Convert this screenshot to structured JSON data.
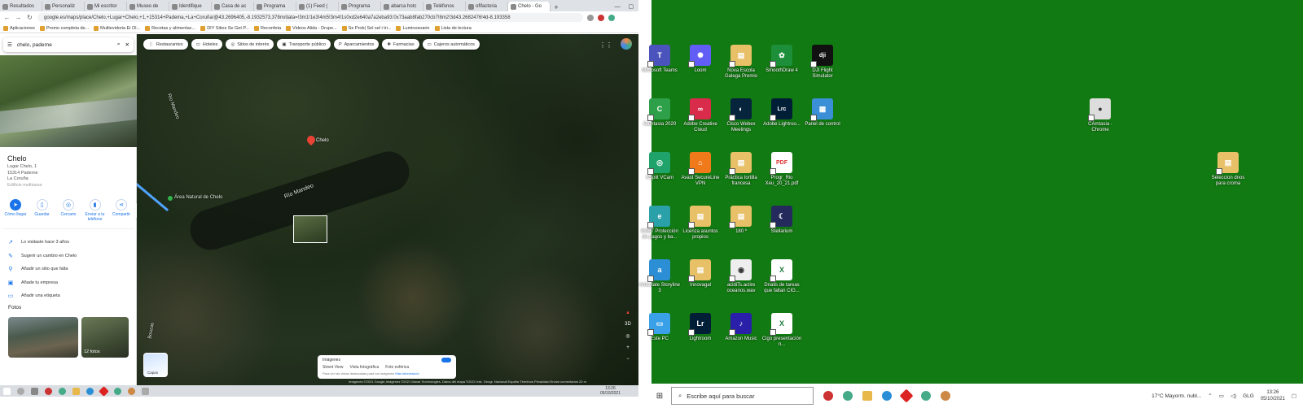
{
  "browser": {
    "tabs": [
      "Resultados",
      "Personaliz",
      "Mi escritor",
      "Museo de",
      "Identifique",
      "Casa de ac",
      "Programa",
      "(1) Feed |",
      "Programa",
      "abarca hotc",
      "Teléfonos",
      "ofifactoria",
      "Chelo - Go"
    ],
    "new_tab": "+",
    "url": "google.es/maps/place/Chelo,+Lugar+Chelo,+1,+15314+Padema,+La+Coruña/@43.2696405,-8.1932573,378m/data=!3m1!1e3!4m5!3m4!1s0xd2e640a7a2eba93:0x73aab8fab270cb7!8m2!3d43.2682476!4d-8.193358",
    "bookmarks": [
      "Aplicaciones",
      "Promo completa de...",
      "Multievidoria Ei Ol...",
      "Recetas y alimentac...",
      "DIY Sitios Se Get P...",
      "Reconfeta",
      "Videos Alida - Drupe...",
      "Se Prob| Sel sel i tri...",
      "Luminosoarin",
      "Lista de lectura"
    ]
  },
  "maps": {
    "search_value": "chelo, paderne",
    "place_title": "Chelo",
    "address_lines": [
      "Lugar Chelo, 1",
      "15314 Paderne",
      "La Coruña"
    ],
    "address_muted": "Edificio multiusos",
    "actions": [
      "Cómo llegar",
      "Guardar",
      "Cercano",
      "Enviar a tu teléfono",
      "Compartir"
    ],
    "menu": [
      {
        "icon": "history-icon",
        "label": "Lo visitaste hace 3 años"
      },
      {
        "icon": "edit-icon",
        "label": "Sugerir un cambio en Chelo"
      },
      {
        "icon": "add-place-icon",
        "label": "Añadir un sitio que falta"
      },
      {
        "icon": "business-icon",
        "label": "Añade tu empresa"
      },
      {
        "icon": "label-icon",
        "label": "Añadir una etiqueta"
      }
    ],
    "photos_heading": "Fotos",
    "photos_count": "12 fotos",
    "chips": [
      "Restaurantes",
      "Hoteles",
      "Sitios de interés",
      "Transporte público",
      "Aparcamientos",
      "Farmacias",
      "Cajeros automáticos"
    ],
    "pin_label": "Chelo",
    "map_labels": {
      "rio_mandeo_a": "Río Mandeo",
      "rio_mandeo_b": "Río Mandeo",
      "area_natural": "Área Natural de Chelo",
      "bouzas": "Bouzas"
    },
    "layers_label": "Capas",
    "imagery": {
      "title": "Imágenes",
      "options": [
        "Street View",
        "Vista fotográfica",
        "Foto esférica"
      ],
      "note": "Para ver las vistas destacadas para tus imágenes",
      "note_link": "Más información"
    },
    "zoom_label": "3D",
    "attribution": "Imágenes ©2021 Google,Imágenes ©2021 Maxar Technologies, Datos del mapa ©2021 Inst. Geogr. Nacional   España   Términos   Privacidad   Enviar comentarios   20 m"
  },
  "left_taskbar": {
    "time": "13:26",
    "date": "05/10/2021"
  },
  "desktop": {
    "icons": [
      {
        "label": "Microsoft Teams",
        "color": "#4b53bc",
        "glyph": "T"
      },
      {
        "label": "Loom",
        "color": "#625df5",
        "glyph": "✺"
      },
      {
        "label": "Nova Escola Galega Premio",
        "color": "#e8c068",
        "glyph": "▤"
      },
      {
        "label": "SmoothDraw 4",
        "color": "#1d8f3a",
        "glyph": "✿"
      },
      {
        "label": "DJI Flight Simulator",
        "color": "#111111",
        "glyph": "dji"
      },
      {
        "label": "Camtasia 2020",
        "color": "#2ea04a",
        "glyph": "C"
      },
      {
        "label": "Adobe Creative Cloud",
        "color": "#d92b4a",
        "glyph": "∞"
      },
      {
        "label": "Cisco Webex Meetings",
        "color": "#06243c",
        "glyph": "◐"
      },
      {
        "label": "Adobe Lightroo...",
        "color": "#001e36",
        "glyph": "Lrc"
      },
      {
        "label": "Panel de control",
        "color": "#3a8fd6",
        "glyph": "▦"
      },
      {
        "label": "CAmtasia - Chrome",
        "color": "#dddddd",
        "glyph": "●"
      },
      {
        "label": "XSplit VCam",
        "color": "#1fa36a",
        "glyph": "◎"
      },
      {
        "label": "Avast SecureLine VPN",
        "color": "#f07a1a",
        "glyph": "⌂"
      },
      {
        "label": "Práctica tortilla francesa",
        "color": "#e8c068",
        "glyph": "▤"
      },
      {
        "label": "Progr_Rio Xeu_20_21.pdf",
        "color": "#ffffff",
        "glyph": "PDF"
      },
      {
        "label": "Seleccion dnos para croma",
        "color": "#e8c068",
        "glyph": "▤"
      },
      {
        "label": "ESET Protección de pagos y ba...",
        "color": "#2aa0a8",
        "glyph": "e"
      },
      {
        "label": "Licenza asuntos propios",
        "color": "#e8c068",
        "glyph": "▤"
      },
      {
        "label": "180 º",
        "color": "#e8c068",
        "glyph": "▤"
      },
      {
        "label": "Stellarium",
        "color": "#242b5c",
        "glyph": "☾"
      },
      {
        "label": "Articulate Storyline 3",
        "color": "#2c8fd6",
        "glyph": "a"
      },
      {
        "label": "Innovagal",
        "color": "#e8c068",
        "glyph": "▤"
      },
      {
        "label": "acidiTs.aclire oceanos.wav",
        "color": "#eeeeee",
        "glyph": "◉"
      },
      {
        "label": "Dnails de tareas que faltan CIG...",
        "color": "#ffffff",
        "glyph": "X"
      },
      {
        "label": "Este PC",
        "color": "#3aa0e8",
        "glyph": "▭"
      },
      {
        "label": "Lightroom",
        "color": "#001e36",
        "glyph": "Lr"
      },
      {
        "label": "Amazon Music",
        "color": "#2a1fa8",
        "glyph": "♪"
      },
      {
        "label": "Cigo presentación n...",
        "color": "#ffffff",
        "glyph": "X"
      }
    ]
  },
  "taskbar": {
    "search_placeholder": "Escribe aquí para buscar",
    "weather": "17°C  Mayorm. nubl...",
    "lang": "GLG",
    "time": "13:26",
    "date": "05/10/2021"
  }
}
